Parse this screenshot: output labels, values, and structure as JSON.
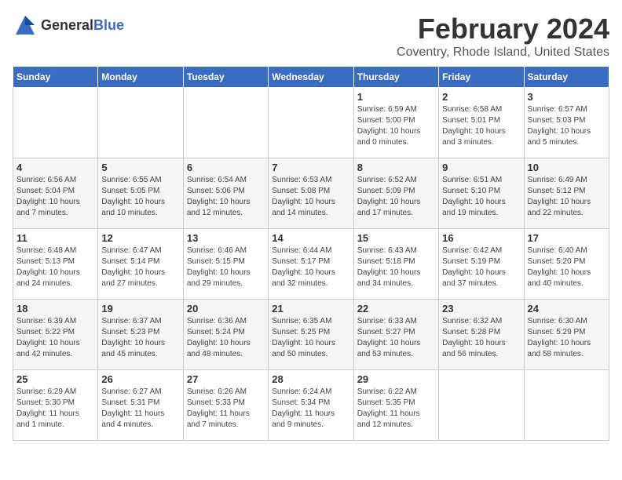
{
  "logo": {
    "general": "General",
    "blue": "Blue"
  },
  "title": "February 2024",
  "location": "Coventry, Rhode Island, United States",
  "days_of_week": [
    "Sunday",
    "Monday",
    "Tuesday",
    "Wednesday",
    "Thursday",
    "Friday",
    "Saturday"
  ],
  "weeks": [
    [
      {
        "day": "",
        "info": ""
      },
      {
        "day": "",
        "info": ""
      },
      {
        "day": "",
        "info": ""
      },
      {
        "day": "",
        "info": ""
      },
      {
        "day": "1",
        "info": "Sunrise: 6:59 AM\nSunset: 5:00 PM\nDaylight: 10 hours\nand 0 minutes."
      },
      {
        "day": "2",
        "info": "Sunrise: 6:58 AM\nSunset: 5:01 PM\nDaylight: 10 hours\nand 3 minutes."
      },
      {
        "day": "3",
        "info": "Sunrise: 6:57 AM\nSunset: 5:03 PM\nDaylight: 10 hours\nand 5 minutes."
      }
    ],
    [
      {
        "day": "4",
        "info": "Sunrise: 6:56 AM\nSunset: 5:04 PM\nDaylight: 10 hours\nand 7 minutes."
      },
      {
        "day": "5",
        "info": "Sunrise: 6:55 AM\nSunset: 5:05 PM\nDaylight: 10 hours\nand 10 minutes."
      },
      {
        "day": "6",
        "info": "Sunrise: 6:54 AM\nSunset: 5:06 PM\nDaylight: 10 hours\nand 12 minutes."
      },
      {
        "day": "7",
        "info": "Sunrise: 6:53 AM\nSunset: 5:08 PM\nDaylight: 10 hours\nand 14 minutes."
      },
      {
        "day": "8",
        "info": "Sunrise: 6:52 AM\nSunset: 5:09 PM\nDaylight: 10 hours\nand 17 minutes."
      },
      {
        "day": "9",
        "info": "Sunrise: 6:51 AM\nSunset: 5:10 PM\nDaylight: 10 hours\nand 19 minutes."
      },
      {
        "day": "10",
        "info": "Sunrise: 6:49 AM\nSunset: 5:12 PM\nDaylight: 10 hours\nand 22 minutes."
      }
    ],
    [
      {
        "day": "11",
        "info": "Sunrise: 6:48 AM\nSunset: 5:13 PM\nDaylight: 10 hours\nand 24 minutes."
      },
      {
        "day": "12",
        "info": "Sunrise: 6:47 AM\nSunset: 5:14 PM\nDaylight: 10 hours\nand 27 minutes."
      },
      {
        "day": "13",
        "info": "Sunrise: 6:46 AM\nSunset: 5:15 PM\nDaylight: 10 hours\nand 29 minutes."
      },
      {
        "day": "14",
        "info": "Sunrise: 6:44 AM\nSunset: 5:17 PM\nDaylight: 10 hours\nand 32 minutes."
      },
      {
        "day": "15",
        "info": "Sunrise: 6:43 AM\nSunset: 5:18 PM\nDaylight: 10 hours\nand 34 minutes."
      },
      {
        "day": "16",
        "info": "Sunrise: 6:42 AM\nSunset: 5:19 PM\nDaylight: 10 hours\nand 37 minutes."
      },
      {
        "day": "17",
        "info": "Sunrise: 6:40 AM\nSunset: 5:20 PM\nDaylight: 10 hours\nand 40 minutes."
      }
    ],
    [
      {
        "day": "18",
        "info": "Sunrise: 6:39 AM\nSunset: 5:22 PM\nDaylight: 10 hours\nand 42 minutes."
      },
      {
        "day": "19",
        "info": "Sunrise: 6:37 AM\nSunset: 5:23 PM\nDaylight: 10 hours\nand 45 minutes."
      },
      {
        "day": "20",
        "info": "Sunrise: 6:36 AM\nSunset: 5:24 PM\nDaylight: 10 hours\nand 48 minutes."
      },
      {
        "day": "21",
        "info": "Sunrise: 6:35 AM\nSunset: 5:25 PM\nDaylight: 10 hours\nand 50 minutes."
      },
      {
        "day": "22",
        "info": "Sunrise: 6:33 AM\nSunset: 5:27 PM\nDaylight: 10 hours\nand 53 minutes."
      },
      {
        "day": "23",
        "info": "Sunrise: 6:32 AM\nSunset: 5:28 PM\nDaylight: 10 hours\nand 56 minutes."
      },
      {
        "day": "24",
        "info": "Sunrise: 6:30 AM\nSunset: 5:29 PM\nDaylight: 10 hours\nand 58 minutes."
      }
    ],
    [
      {
        "day": "25",
        "info": "Sunrise: 6:29 AM\nSunset: 5:30 PM\nDaylight: 11 hours\nand 1 minute."
      },
      {
        "day": "26",
        "info": "Sunrise: 6:27 AM\nSunset: 5:31 PM\nDaylight: 11 hours\nand 4 minutes."
      },
      {
        "day": "27",
        "info": "Sunrise: 6:26 AM\nSunset: 5:33 PM\nDaylight: 11 hours\nand 7 minutes."
      },
      {
        "day": "28",
        "info": "Sunrise: 6:24 AM\nSunset: 5:34 PM\nDaylight: 11 hours\nand 9 minutes."
      },
      {
        "day": "29",
        "info": "Sunrise: 6:22 AM\nSunset: 5:35 PM\nDaylight: 11 hours\nand 12 minutes."
      },
      {
        "day": "",
        "info": ""
      },
      {
        "day": "",
        "info": ""
      }
    ]
  ]
}
